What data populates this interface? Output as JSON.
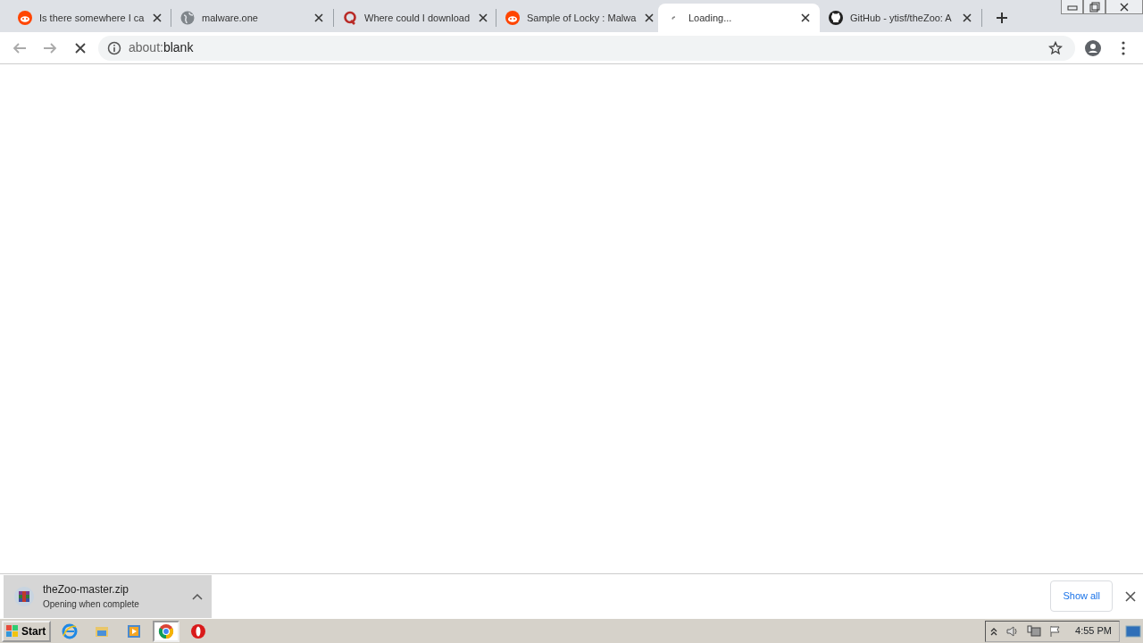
{
  "tabs": [
    {
      "kind": "reddit",
      "title": "Is there somewhere I ca",
      "selected": false
    },
    {
      "kind": "globe",
      "title": "malware.one",
      "selected": false
    },
    {
      "kind": "quora",
      "title": "Where could I download",
      "selected": false
    },
    {
      "kind": "reddit",
      "title": "Sample of Locky : Malwa",
      "selected": false
    },
    {
      "kind": "spinner",
      "title": "Loading...",
      "selected": true
    },
    {
      "kind": "github",
      "title": "GitHub - ytisf/theZoo: A",
      "selected": false
    }
  ],
  "toolbar": {
    "url_prefix": "about:",
    "url_host": "blank",
    "loading": true
  },
  "download": {
    "filename": "theZoo-master.zip",
    "status": "Opening when complete",
    "show_all": "Show all"
  },
  "taskbar": {
    "start": "Start",
    "apps": [
      {
        "kind": "ie",
        "selected": false
      },
      {
        "kind": "folder",
        "selected": false
      },
      {
        "kind": "media",
        "selected": false
      },
      {
        "kind": "chrome",
        "selected": true
      },
      {
        "kind": "opera",
        "selected": false
      }
    ],
    "clock": "4:55 PM"
  }
}
